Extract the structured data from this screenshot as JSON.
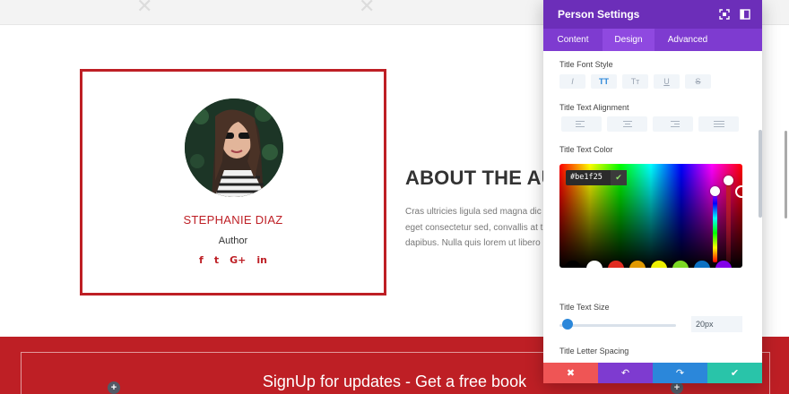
{
  "page": {
    "person": {
      "name": "STEPHANIE DIAZ",
      "role": "Author",
      "socials": [
        "f",
        "t",
        "G+",
        "in"
      ]
    },
    "about": {
      "title": "ABOUT THE AUTH",
      "body_lines": [
        "Cras ultricies ligula sed magna dic",
        "eget consectetur sed, convallis at t",
        "dapibus. Nulla quis lorem ut libero"
      ]
    },
    "signup": {
      "title": "SignUp for updates - Get a free book",
      "add": "+"
    }
  },
  "modal": {
    "title": "Person Settings",
    "tabs": [
      {
        "label": "Content",
        "active": false
      },
      {
        "label": "Design",
        "active": true
      },
      {
        "label": "Advanced",
        "active": false
      }
    ],
    "title_font_style": {
      "label": "Title Font Style",
      "options": [
        {
          "glyph": "I",
          "name": "italic",
          "active": false
        },
        {
          "glyph": "TT",
          "name": "uppercase",
          "active": true
        },
        {
          "glyph": "Tт",
          "name": "capitalize",
          "active": false
        },
        {
          "glyph": "U",
          "name": "underline",
          "active": false
        },
        {
          "glyph": "S",
          "name": "strikethrough",
          "active": false
        }
      ]
    },
    "title_text_alignment": {
      "label": "Title Text Alignment",
      "options": [
        "left",
        "center",
        "right",
        "justify"
      ]
    },
    "title_text_color": {
      "label": "Title Text Color",
      "hex": "#be1f25",
      "swatches": [
        "#000000",
        "#ffffff",
        "#e02b20",
        "#e09900",
        "#edf000",
        "#7cda24",
        "#0c71c3",
        "#8300e9"
      ]
    },
    "title_text_size": {
      "label": "Title Text Size",
      "value": "20px"
    },
    "title_letter_spacing": {
      "label": "Title Letter Spacing"
    }
  },
  "colors": {
    "brand_red": "#be1f25",
    "modal_purple": "#6c2eb9",
    "accent_blue": "#2b87da",
    "save_green": "#29c4a9",
    "close_red": "#ef5555"
  }
}
